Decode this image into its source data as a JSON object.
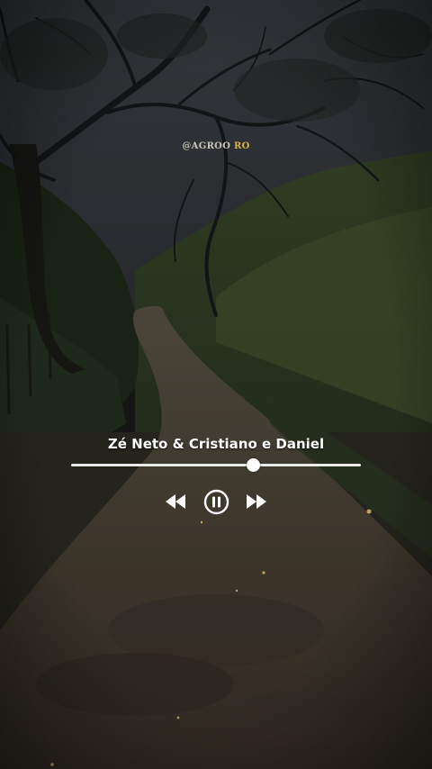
{
  "watermark": {
    "part1": "@AGROO",
    "part2": " RO"
  },
  "player": {
    "track_title": "Zé Neto & Cristiano e Daniel",
    "progress_fraction": 0.63,
    "state": "playing",
    "controls": {
      "previous": "rewind-icon",
      "pause": "pause-circle-icon",
      "next": "fast-forward-icon"
    }
  },
  "colors": {
    "text": "#ffffff",
    "progress_track": "#e9e9e9",
    "watermark_accent": "#d9b24a"
  }
}
